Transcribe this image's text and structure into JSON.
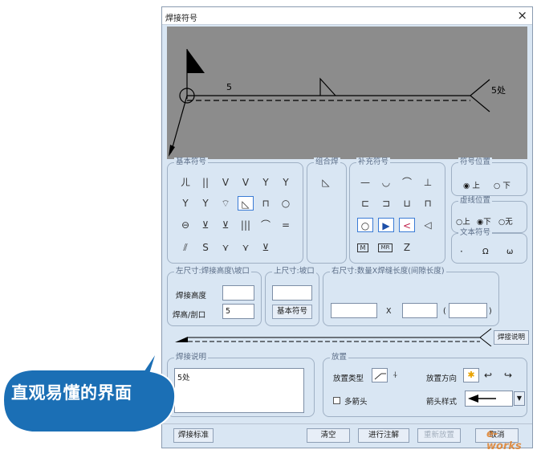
{
  "dialog": {
    "title": "焊接符号",
    "close": "×"
  },
  "preview": {
    "left_size": "5",
    "note": "5处"
  },
  "basic": {
    "title": "基本符号",
    "rows": [
      [
        "ㄦ",
        "||",
        "V",
        "V",
        "Y",
        "Y"
      ],
      [
        "Y",
        "Y",
        "⌔",
        "◺",
        "⊓",
        "○"
      ],
      [
        "⊖",
        "⊻",
        "⊻",
        "|||",
        "⌒",
        "="
      ],
      [
        "⫽",
        "S",
        "⋎",
        "⋎",
        "⊻"
      ]
    ]
  },
  "combo": {
    "title": "组合焊",
    "sym": "◺"
  },
  "supp": {
    "title": "补充符号",
    "rows": [
      [
        "—",
        "◡",
        "⌒",
        "⊥"
      ],
      [
        "⊏",
        "⊐",
        "⊔",
        "⊓"
      ],
      [
        "○",
        "▶",
        "<",
        "◁"
      ],
      [
        "M",
        "MR",
        "Z"
      ]
    ]
  },
  "pos": {
    "title": "符号位置",
    "up": "上",
    "down": "下"
  },
  "dash": {
    "title": "虚线位置",
    "up": "上",
    "down": "下",
    "none": "无"
  },
  "text_sym": {
    "title": "文本符号",
    "items": [
      "·",
      "Ω",
      "ω"
    ]
  },
  "left_size": {
    "title": "左尺寸:焊接高度\\坡口",
    "height_label": "焊接高度",
    "height_value": "",
    "ratio_label": "焊高/剖口",
    "ratio_value": "5"
  },
  "upper_size": {
    "title": "上尺寸:坡口",
    "value": "",
    "button": "基本符号"
  },
  "right_size": {
    "title": "右尺寸:数量X焊缝长度(间隙长度)",
    "x": "X",
    "lp": "(",
    "rp": ")"
  },
  "leader": {
    "button": "焊接说明"
  },
  "desc": {
    "title": "焊接说明",
    "value": "5处"
  },
  "place": {
    "title": "放置",
    "type_label": "放置类型",
    "dir_label": "放置方向",
    "multi_label": "多箭头",
    "style_label": "箭头样式"
  },
  "footer": {
    "standard": "焊接标准",
    "clear": "清空",
    "annotate": "进行注解",
    "replace": "重新放置",
    "cancel": "取消"
  },
  "watermark": "e-works",
  "callout": "直观易懂的界面"
}
